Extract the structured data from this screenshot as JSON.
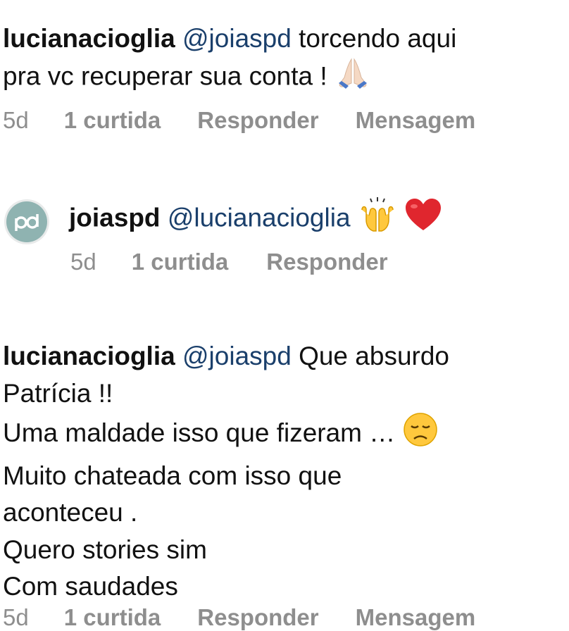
{
  "comments": [
    {
      "username": "lucianacioglia",
      "mention": "@joiaspd",
      "line1_rest": "torcendo aqui",
      "line2": "pra vc recuperar sua conta !",
      "emoji": "folded-hands",
      "time": "5d",
      "likes": "1 curtida",
      "reply": "Responder",
      "message": "Mensagem"
    },
    {
      "username": "joiaspd",
      "mention": "@lucianacioglia",
      "emojis": [
        "raising-hands",
        "red-heart"
      ],
      "time": "5d",
      "likes": "1 curtida",
      "reply": "Responder"
    },
    {
      "username": "lucianacioglia",
      "mention": "@joiaspd",
      "line1_rest": "Que absurdo",
      "line2": "Patrícia !!",
      "line3": "Uma maldade isso que fizeram …",
      "line3_emoji": "disappointed-face",
      "line4": "Muito chateada com isso que",
      "line5": "aconteceu .",
      "line6": "Quero stories sim",
      "line7": "Com saudades",
      "time": "5d",
      "likes": "1 curtida",
      "reply": "Responder",
      "message": "Mensagem"
    }
  ],
  "colors": {
    "text": "#111111",
    "mention": "#1a3f6b",
    "meta": "#8e8e8e",
    "avatar": "#8fb3b1"
  }
}
